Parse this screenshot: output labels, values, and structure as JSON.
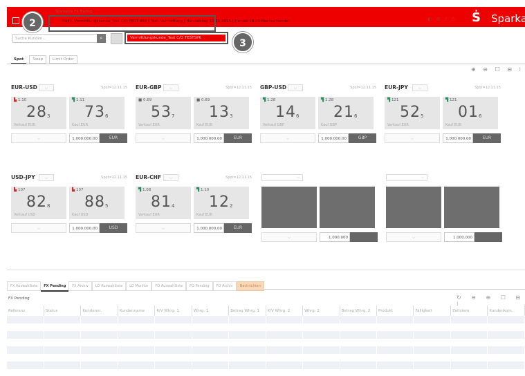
{
  "window": {
    "title": "Sparkasse FX Trading",
    "info_line": "Hallo, Vermittlungskunde_Test C/O TEST 999 | Test, Vermittlung | Handelstag 12.11.2015 | Handel 18.05 Boerse/Handel",
    "brand": "Sparkasse",
    "logo_glyph": "Ṡ",
    "header_color": "#ee0000"
  },
  "callouts": {
    "badge_2": "2",
    "badge_3": "3"
  },
  "customer": {
    "search_placeholder": "Suche Kunden...",
    "search_icon": "search-icon",
    "search_glyph": "⌕",
    "selected": "Vermittlungskunde_Test C/O TESTSPK"
  },
  "trade_tabs": [
    "Spot",
    "Swap",
    "Limit Order"
  ],
  "toolbar_glyphs": "⊕ ⊖ ☐ ⊟ ⁞",
  "tiles": [
    {
      "pair": "EUR-USD",
      "spot": "Spot=12.11.15",
      "sell": {
        "dir": "down",
        "arrow": "▙",
        "tag": "1.10",
        "big": "28",
        "sub": "3",
        "label": "Verkauf EUR"
      },
      "buy": {
        "dir": "up",
        "arrow": "▜",
        "tag": "1.11",
        "big": "73",
        "sub": "6",
        "label": "Kauf EUR"
      },
      "amount": "1.000.000,00",
      "currency": "EUR"
    },
    {
      "pair": "EUR-GBP",
      "spot": "Spot=12.11.15",
      "sell": {
        "dir": "flat",
        "arrow": "■",
        "tag": "0.69",
        "big": "53",
        "sub": "7",
        "label": "Verkauf EUR"
      },
      "buy": {
        "dir": "flat",
        "arrow": "■",
        "tag": "0.69",
        "big": "13",
        "sub": "3",
        "label": "Kauf EUR"
      },
      "amount": "1.000.000,00",
      "currency": "EUR"
    },
    {
      "pair": "GBP-USD",
      "spot": "Spot=12.11.15",
      "sell": {
        "dir": "up",
        "arrow": "▜",
        "tag": "1.28",
        "big": "14",
        "sub": "6",
        "label": "Verkauf GBP"
      },
      "buy": {
        "dir": "up",
        "arrow": "▜",
        "tag": "1.28",
        "big": "21",
        "sub": "6",
        "label": "Kauf GBP"
      },
      "amount": "1.000.000,00",
      "currency": "GBP"
    },
    {
      "pair": "EUR-JPY",
      "spot": "Spot=12.11.15",
      "sell": {
        "dir": "up",
        "arrow": "▜",
        "tag": "121",
        "big": "52",
        "sub": "5",
        "label": "Verkauf EUR"
      },
      "buy": {
        "dir": "up",
        "arrow": "▜",
        "tag": "121",
        "big": "01",
        "sub": "6",
        "label": "Kauf EUR"
      },
      "amount": "1.000.000,00",
      "currency": "EUR"
    },
    {
      "pair": "USD-JPY",
      "spot": "Spot=12.11.15",
      "sell": {
        "dir": "down",
        "arrow": "▙",
        "tag": "107",
        "big": "82",
        "sub": "8",
        "label": "Verkauf USD"
      },
      "buy": {
        "dir": "down",
        "arrow": "▙",
        "tag": "107",
        "big": "88",
        "sub": "5",
        "label": "Kauf USD"
      },
      "amount": "1.000.000,00",
      "currency": "USD"
    },
    {
      "pair": "EUR-CHF",
      "spot": "Spot=12.11.15",
      "sell": {
        "dir": "up",
        "arrow": "▜",
        "tag": "1.08",
        "big": "81",
        "sub": "4",
        "label": "Verkauf EUR"
      },
      "buy": {
        "dir": "up",
        "arrow": "▜",
        "tag": "1.10",
        "big": "12",
        "sub": "2",
        "label": "Kauf EUR"
      },
      "amount": "1.000.000,00",
      "currency": "EUR"
    }
  ],
  "empty_tiles": [
    {
      "amount": "1.000.000"
    },
    {
      "amount": "1.000.000"
    }
  ],
  "dropdown_glyph": "⌵",
  "bottom_tabs": [
    "FX Auswahlliste",
    "FX Pending",
    "FX Archiv",
    "LO Auswahlliste",
    "LO Monitor",
    "FO Auswahlliste",
    "FO Pending",
    "FO Archiv",
    "Nachrichten"
  ],
  "bottom_active": "FX Pending",
  "grid_title": "FX Pending",
  "grid_toolbar_glyphs": "↻ ⊖ ⊕ ☐ ⊟ ⁞",
  "columns": [
    "Referenz",
    "Status",
    "Kundennr.",
    "Kundenname",
    "K/V Whrg. 1",
    "Whrg. 1",
    "Betrag Whrg. 1",
    "K/V Whrg. 2",
    "Whrg. 2",
    "Betrag Whrg. 2",
    "Produkt",
    "Fälligkeit",
    "Zeitstem",
    "Kundenkom."
  ],
  "rows": 7
}
